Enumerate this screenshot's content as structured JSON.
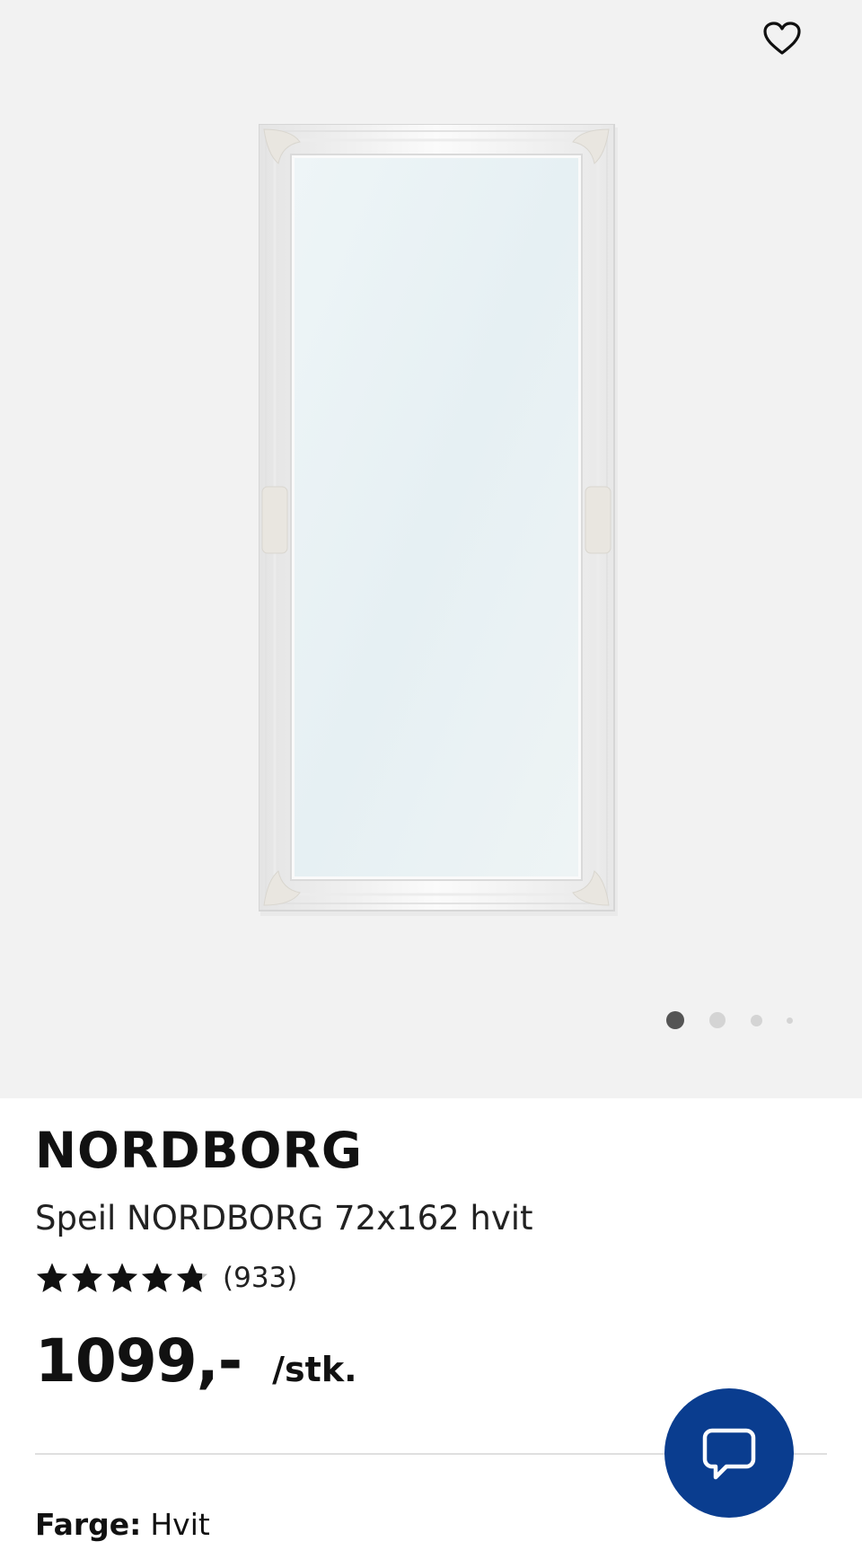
{
  "gallery": {
    "image_alt": "Speil NORDBORG 72x162 hvit",
    "slide_count": 4,
    "active_slide": 1,
    "favorite_icon": "heart-outline-icon"
  },
  "product": {
    "brand": "NORDBORG",
    "subtitle": "Speil NORDBORG 72x162 hvit",
    "rating": {
      "stars_value": 4.8,
      "stars_max": 5,
      "count_label": "(933)"
    },
    "price": {
      "amount": "1099,-",
      "unit": "/stk."
    },
    "color": {
      "label": "Farge:",
      "value": "Hvit"
    }
  },
  "chat": {
    "icon": "chat-bubble-icon",
    "color": "#0a3d8f"
  }
}
